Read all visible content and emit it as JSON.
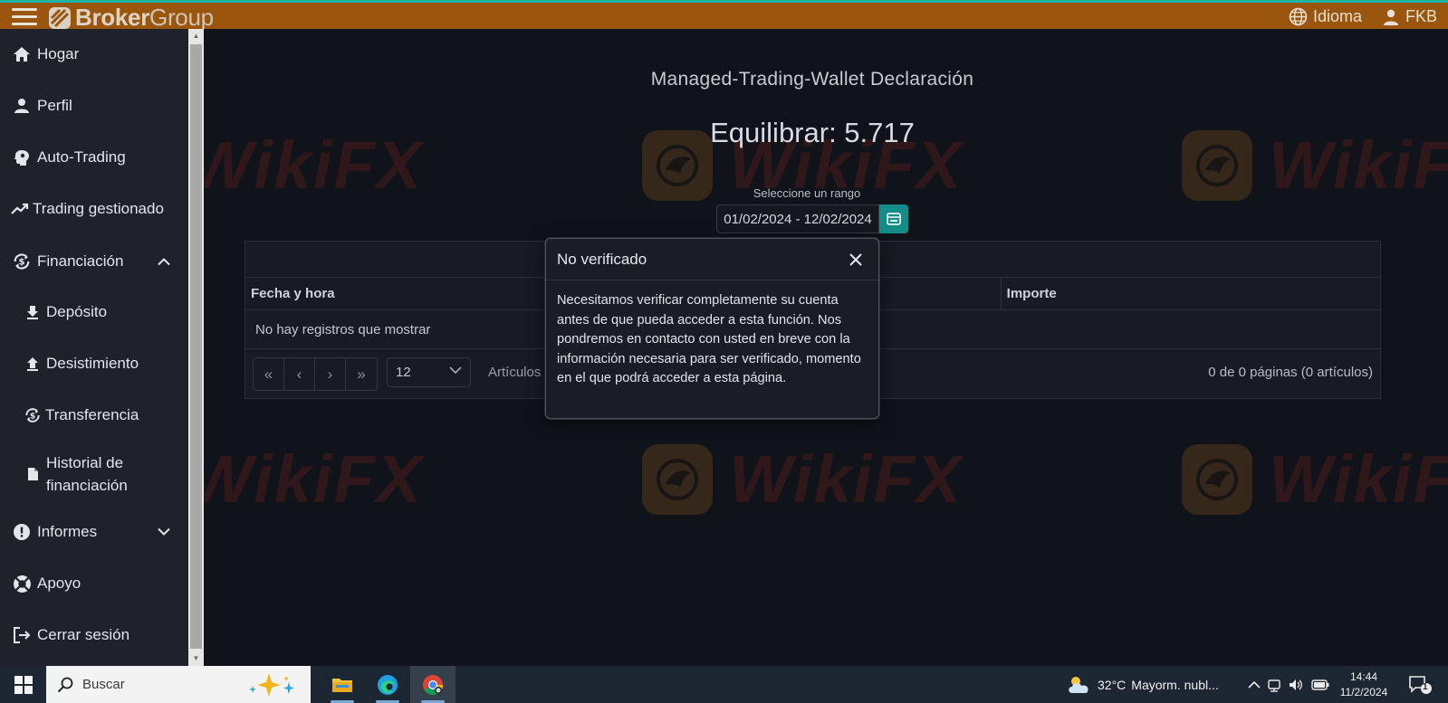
{
  "topbar": {
    "brand_bold": "Broker",
    "brand_light": "Group",
    "language_label": "Idioma",
    "user_label": "FKB"
  },
  "sidebar": {
    "items": [
      {
        "label": "Hogar",
        "icon": "home-icon"
      },
      {
        "label": "Perfil",
        "icon": "user-icon"
      },
      {
        "label": "Auto-Trading",
        "icon": "brain-icon"
      },
      {
        "label": "Trading gestionado",
        "icon": "trend-icon"
      },
      {
        "label": "Financiación",
        "icon": "dollar-cycle-icon",
        "expanded": true
      },
      {
        "label": "Depósito",
        "icon": "download-icon"
      },
      {
        "label": "Desistimiento",
        "icon": "upload-icon"
      },
      {
        "label": "Transferencia",
        "icon": "transfer-icon"
      },
      {
        "label_line1": "Historial de",
        "label_line2": "financiación",
        "icon": "document-icon"
      },
      {
        "label": "Informes",
        "icon": "alert-icon",
        "expanded": false
      },
      {
        "label": "Apoyo",
        "icon": "lifebuoy-icon"
      },
      {
        "label": "Cerrar sesión",
        "icon": "logout-icon"
      }
    ]
  },
  "main": {
    "title": "Managed-Trading-Wallet Declaración",
    "balance": "Equilibrar: 5.717",
    "range_label": "Seleccione un rango",
    "range_value": "01/02/2024 - 12/02/2024",
    "table": {
      "columns": [
        "Fecha y hora",
        "Importe"
      ],
      "empty_text": "No hay registros que mostrar",
      "pager": [
        "«",
        "‹",
        "›",
        "»"
      ],
      "page_size": "12",
      "items_label": "Artículos",
      "page_info": "0 de 0 páginas (0 artículos)"
    }
  },
  "watermark": "WikiFX",
  "modal": {
    "title": "No verificado",
    "body": "Necesitamos verificar completamente su cuenta antes de que pueda acceder a esta función. Nos pondremos en contacto con usted en breve con la información necesaria para ser verificado, momento en el que podrá acceder a esta página."
  },
  "taskbar": {
    "search_label": "Buscar",
    "weather_temp": "32°C",
    "weather_text": "Mayorm. nubl...",
    "time": "14:44",
    "date": "11/2/2024",
    "notification_count": "1"
  },
  "colors": {
    "topbar": "#9a560c",
    "accent": "#148c87",
    "background": "#10131a",
    "sidebar": "#1f2229"
  }
}
